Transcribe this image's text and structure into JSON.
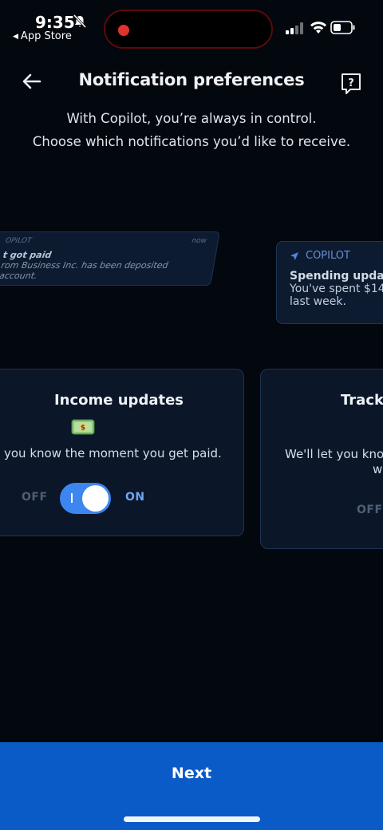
{
  "status_bar": {
    "time": "9:35",
    "back_app": "App Store"
  },
  "header": {
    "title": "Notification preferences",
    "subtitle_line1": "With Copilot, you’re always in control.",
    "subtitle_line2": "Choose which notifications you’d like to receive."
  },
  "previews": {
    "left": {
      "app": "OPILOT",
      "time": "now",
      "title": "t got paid",
      "body_line1": "rom Business Inc. has been deposited",
      "body_line2": "account."
    },
    "right": {
      "app": "COPILOT",
      "title": "Spending updat",
      "body_line1": "You've spent $14",
      "body_line2": "last week."
    }
  },
  "cards": {
    "income": {
      "title": "Income updates",
      "emoji": "money-bag-emoji",
      "description": "you know the moment you get paid.",
      "off_label": "OFF",
      "on_label": "ON",
      "enabled": true
    },
    "track": {
      "title": "Track",
      "description": "We'll let you know",
      "description_line2": "w",
      "off_label": "OFF"
    }
  },
  "footer": {
    "next_label": "Next"
  },
  "colors": {
    "background": "#03070e",
    "card": "#0b1628",
    "accent": "#3d86f0",
    "button": "#0a5bc8"
  }
}
